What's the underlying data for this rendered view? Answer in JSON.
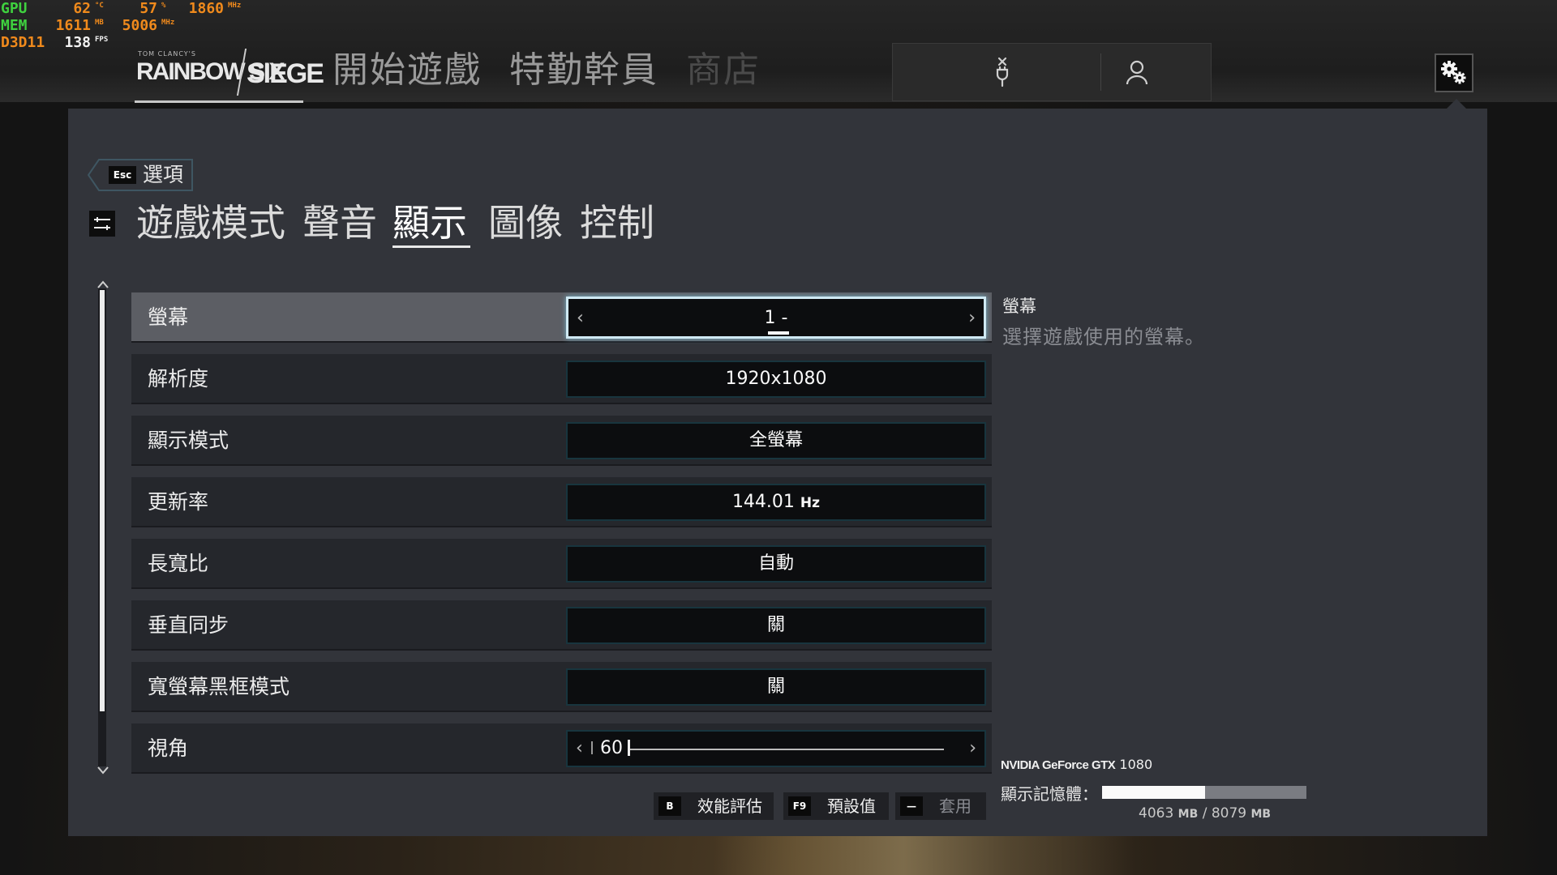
{
  "overlay": {
    "rows": [
      {
        "key": "GPU",
        "key_color": "#3fd13f",
        "items": [
          {
            "value": "62",
            "unit": "°C",
            "color": "#f08a1c"
          },
          {
            "value": "57",
            "unit": "%",
            "color": "#f08a1c"
          },
          {
            "value": "1860",
            "unit": "MHz",
            "color": "#f08a1c"
          }
        ]
      },
      {
        "key": "MEM",
        "key_color": "#3fd13f",
        "items": [
          {
            "value": "1611",
            "unit": "MB",
            "color": "#f08a1c"
          },
          {
            "value": "5006",
            "unit": "MHz",
            "color": "#f08a1c"
          }
        ]
      },
      {
        "key": "D3D11",
        "key_color": "#f08a1c",
        "items": [
          {
            "value": "138",
            "unit": "FPS",
            "color": "#f2f2f2"
          }
        ]
      }
    ]
  },
  "header": {
    "logo_small": "TOM CLANCY'S",
    "logo_left": "RAINBOW SIX",
    "logo_right": "SIEGE",
    "nav_tabs": [
      {
        "label": "開始遊戲",
        "color": "#9a9a9a"
      },
      {
        "label": "特勤幹員",
        "color": "#9a9a9a"
      },
      {
        "label": "商店",
        "color": "#4a4a4a"
      }
    ],
    "user_icons": [
      "controller-disconnected-icon",
      "user-icon"
    ],
    "settings_icon": "gear-icon"
  },
  "options": {
    "back_key": "Esc",
    "back_label": "選項",
    "tabs": [
      {
        "label": "遊戲模式",
        "active": false
      },
      {
        "label": "聲音",
        "active": false
      },
      {
        "label": "顯示",
        "active": true
      },
      {
        "label": "圖像",
        "active": false
      },
      {
        "label": "控制",
        "active": false
      }
    ]
  },
  "settings": [
    {
      "label": "螢幕",
      "value": "1 -",
      "type": "selector",
      "selected": true
    },
    {
      "label": "解析度",
      "value": "1920x1080",
      "type": "dropdown"
    },
    {
      "label": "顯示模式",
      "value": "全螢幕",
      "type": "dropdown"
    },
    {
      "label": "更新率",
      "value": "144.01",
      "unit": "Hz",
      "type": "dropdown"
    },
    {
      "label": "長寬比",
      "value": "自動",
      "type": "dropdown"
    },
    {
      "label": "垂直同步",
      "value": "關",
      "type": "dropdown"
    },
    {
      "label": "寬螢幕黑框模式",
      "value": "關",
      "type": "dropdown"
    },
    {
      "label": "視角",
      "value": "60",
      "type": "slider"
    }
  ],
  "description": {
    "title": "螢幕",
    "body": "選擇遊戲使用的螢幕。"
  },
  "gpu": {
    "brand": "NVIDIA GeForce GTX",
    "model": "1080",
    "vram_label": "顯示記憶體：",
    "vram_used": "4063",
    "vram_total": "8079",
    "vram_unit": "MB",
    "vram_sep": "/",
    "vram_fraction": 0.503
  },
  "footer_buttons": [
    {
      "key": "B",
      "label": "效能評估",
      "enabled": true
    },
    {
      "key": "F9",
      "label": "預設值",
      "enabled": true
    },
    {
      "key": "—",
      "label": "套用",
      "enabled": false
    }
  ],
  "colors": {
    "panel": "#32343a",
    "row": "#25272c",
    "row_selected": "#5c5e64",
    "value_border_active": "#cfe9f3"
  }
}
